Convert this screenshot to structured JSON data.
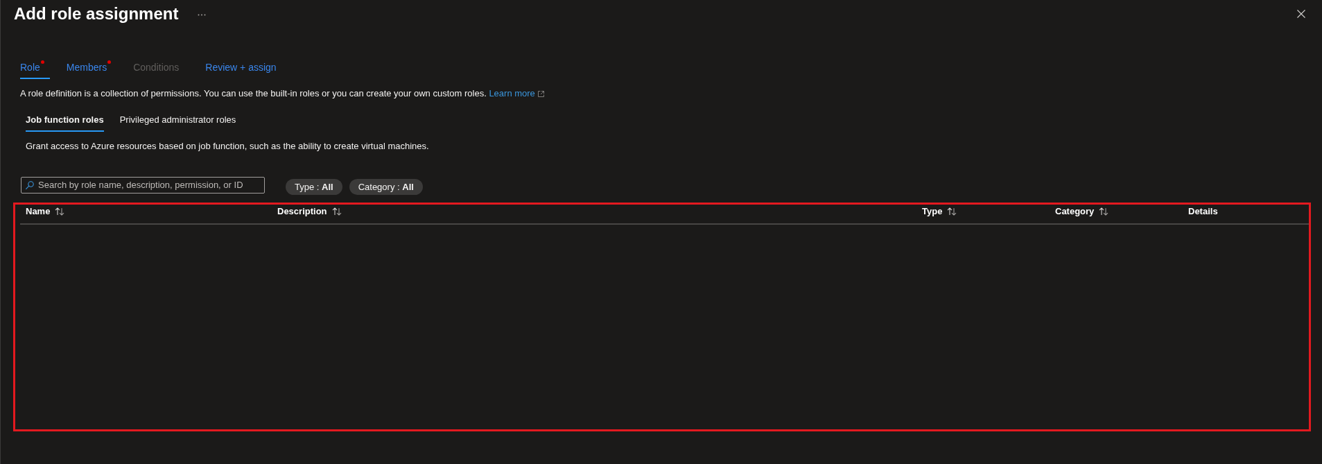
{
  "window": {
    "title": "Add role assignment"
  },
  "tabs": [
    {
      "label": "Role",
      "selected": true,
      "required": true,
      "disabled": false
    },
    {
      "label": "Members",
      "selected": false,
      "required": true,
      "disabled": false
    },
    {
      "label": "Conditions",
      "selected": false,
      "required": false,
      "disabled": true
    },
    {
      "label": "Review + assign",
      "selected": false,
      "required": false,
      "disabled": false
    }
  ],
  "description": {
    "text": "A role definition is a collection of permissions. You can use the built-in roles or you can create your own custom roles.",
    "link": "Learn more"
  },
  "role_tabs": [
    {
      "label": "Job function roles",
      "selected": true
    },
    {
      "label": "Privileged administrator roles",
      "selected": false
    }
  ],
  "role_tab_description": "Grant access to Azure resources based on job function, such as the ability to create virtual machines.",
  "search": {
    "placeholder": "Search by role name, description, permission, or ID"
  },
  "filters": [
    {
      "label": "Type : ",
      "value": "All"
    },
    {
      "label": "Category : ",
      "value": "All"
    }
  ],
  "table": {
    "highlighted": true,
    "columns": [
      {
        "label": "Name",
        "sortable": true
      },
      {
        "label": "Description",
        "sortable": true
      },
      {
        "label": "Type",
        "sortable": true
      },
      {
        "label": "Category",
        "sortable": true
      },
      {
        "label": "Details",
        "sortable": false
      }
    ]
  }
}
